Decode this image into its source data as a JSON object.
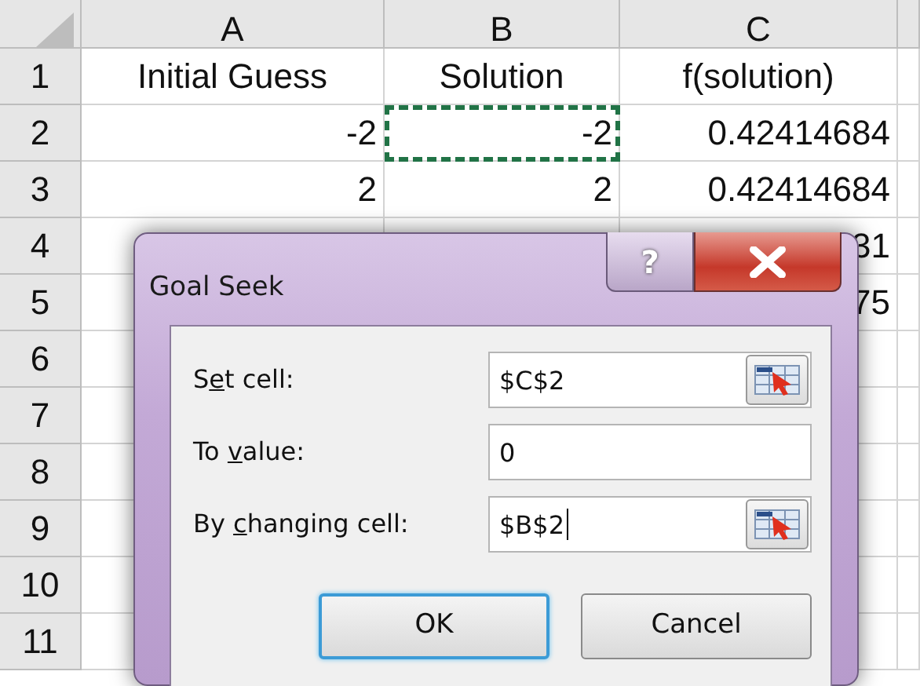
{
  "sheet": {
    "columns": [
      "A",
      "B",
      "C"
    ],
    "rows": [
      {
        "header": "1",
        "cells": [
          {
            "kind": "label",
            "text": "Initial Guess",
            "marquee": false
          },
          {
            "kind": "label",
            "text": "Solution",
            "marquee": false
          },
          {
            "kind": "label",
            "text": "f(solution)",
            "marquee": false
          }
        ]
      },
      {
        "header": "2",
        "cells": [
          {
            "kind": "number",
            "text": "-2",
            "marquee": false
          },
          {
            "kind": "number",
            "text": "-2",
            "marquee": true
          },
          {
            "kind": "number",
            "text": "0.42414684",
            "marquee": false
          }
        ]
      },
      {
        "header": "3",
        "cells": [
          {
            "kind": "number",
            "text": "2",
            "marquee": false
          },
          {
            "kind": "number",
            "text": "2",
            "marquee": false
          },
          {
            "kind": "number",
            "text": "0.42414684",
            "marquee": false
          }
        ]
      },
      {
        "header": "4",
        "cells": [
          {
            "kind": "number",
            "marquee": false
          },
          {
            "kind": "number",
            "marquee": false
          },
          {
            "kind": "number",
            "text": "31",
            "marquee": false
          }
        ]
      },
      {
        "header": "5",
        "cells": [
          {
            "kind": "number",
            "marquee": false
          },
          {
            "kind": "number",
            "marquee": false
          },
          {
            "kind": "number",
            "text": "75",
            "marquee": false
          }
        ]
      },
      {
        "header": "6",
        "cells": [
          {
            "kind": "number",
            "marquee": false
          },
          {
            "kind": "number",
            "marquee": false
          },
          {
            "kind": "number",
            "marquee": false
          }
        ]
      },
      {
        "header": "7",
        "cells": [
          {
            "kind": "number",
            "marquee": false
          },
          {
            "kind": "number",
            "marquee": false
          },
          {
            "kind": "number",
            "marquee": false
          }
        ]
      },
      {
        "header": "8",
        "cells": [
          {
            "kind": "number",
            "marquee": false
          },
          {
            "kind": "number",
            "marquee": false
          },
          {
            "kind": "number",
            "marquee": false
          }
        ]
      },
      {
        "header": "9",
        "cells": [
          {
            "kind": "number",
            "marquee": false
          },
          {
            "kind": "number",
            "marquee": false
          },
          {
            "kind": "number",
            "marquee": false
          }
        ]
      },
      {
        "header": "10",
        "cells": [
          {
            "kind": "number",
            "marquee": false
          },
          {
            "kind": "number",
            "marquee": false
          },
          {
            "kind": "number",
            "marquee": false
          }
        ]
      },
      {
        "header": "11",
        "cells": [
          {
            "kind": "number",
            "marquee": false
          },
          {
            "kind": "number",
            "marquee": false
          },
          {
            "kind": "number",
            "marquee": false
          }
        ]
      }
    ]
  },
  "dialog": {
    "title": "Goal Seek",
    "help_button": "?",
    "fields": [
      {
        "label_start": "S",
        "label_key": "e",
        "label_end": "t cell:",
        "value": "$C$2",
        "picker": true,
        "focused": false
      },
      {
        "label_start": "To ",
        "label_key": "v",
        "label_end": "alue:",
        "value": "0",
        "picker": false,
        "focused": false
      },
      {
        "label_start": "By ",
        "label_key": "c",
        "label_end": "hanging cell:",
        "value": "$B$2",
        "picker": true,
        "focused": true
      }
    ],
    "buttons": [
      {
        "label": "OK",
        "default": true
      },
      {
        "label": "Cancel",
        "default": false
      }
    ]
  }
}
